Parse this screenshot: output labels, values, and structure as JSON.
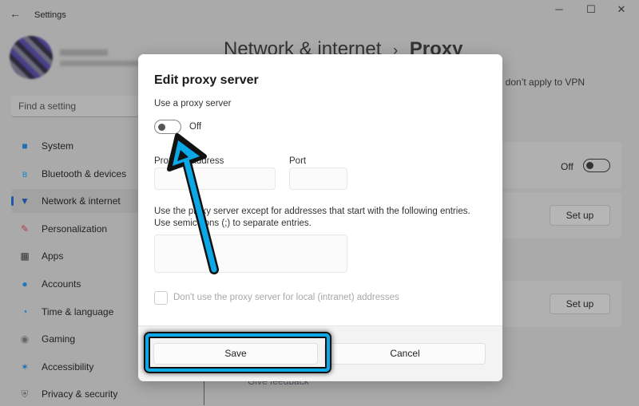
{
  "window": {
    "title": "Settings",
    "back_icon": "arrow-left-icon",
    "minimize": "─",
    "maximize": "☐",
    "close": "✕"
  },
  "search": {
    "placeholder": "Find a setting"
  },
  "sidebar": {
    "items": [
      {
        "label": "System",
        "icon": "■",
        "color": "#1e6fb5"
      },
      {
        "label": "Bluetooth & devices",
        "icon": "ʙ",
        "color": "#1e88c8"
      },
      {
        "label": "Network & internet",
        "icon": "▼",
        "color": "#1e4fa0",
        "active": true
      },
      {
        "label": "Personalization",
        "icon": "✎",
        "color": "#b04040"
      },
      {
        "label": "Apps",
        "icon": "▦",
        "color": "#333"
      },
      {
        "label": "Accounts",
        "icon": "●",
        "color": "#1e78b8"
      },
      {
        "label": "Time & language",
        "icon": "◔",
        "color": "#2a7ab8"
      },
      {
        "label": "Gaming",
        "icon": "◉",
        "color": "#666"
      },
      {
        "label": "Accessibility",
        "icon": "✶",
        "color": "#1e6fb5"
      },
      {
        "label": "Privacy & security",
        "icon": "⛨",
        "color": "#666"
      }
    ]
  },
  "main": {
    "breadcrumb_parent": "Network & internet",
    "breadcrumb_sep": "›",
    "breadcrumb_current": "Proxy",
    "vpn_note": "ngs don’t apply to VPN",
    "auto_toggle_state": "Off",
    "setup_button_1": "Set up",
    "setup_button_2": "Set up",
    "feedback": "Give feedback"
  },
  "dialog": {
    "title": "Edit proxy server",
    "use_proxy_label": "Use a proxy server",
    "toggle_state": "Off",
    "toggle_on": false,
    "proxy_address_label": "Proxy IP address",
    "proxy_address_value": "",
    "port_label": "Port",
    "port_value": "",
    "exceptions_label_1": "Use the proxy server except for addresses that start with the following entries.",
    "exceptions_label_2": "Use semicolons (;) to separate entries.",
    "exceptions_value": "",
    "local_checkbox_label": "Don't use the proxy server for local (intranet) addresses",
    "local_checkbox_checked": false,
    "save_label": "Save",
    "cancel_label": "Cancel"
  },
  "annotation": {
    "arrow_color": "#0aa8e6",
    "highlight_color": "#0aa8e6"
  }
}
